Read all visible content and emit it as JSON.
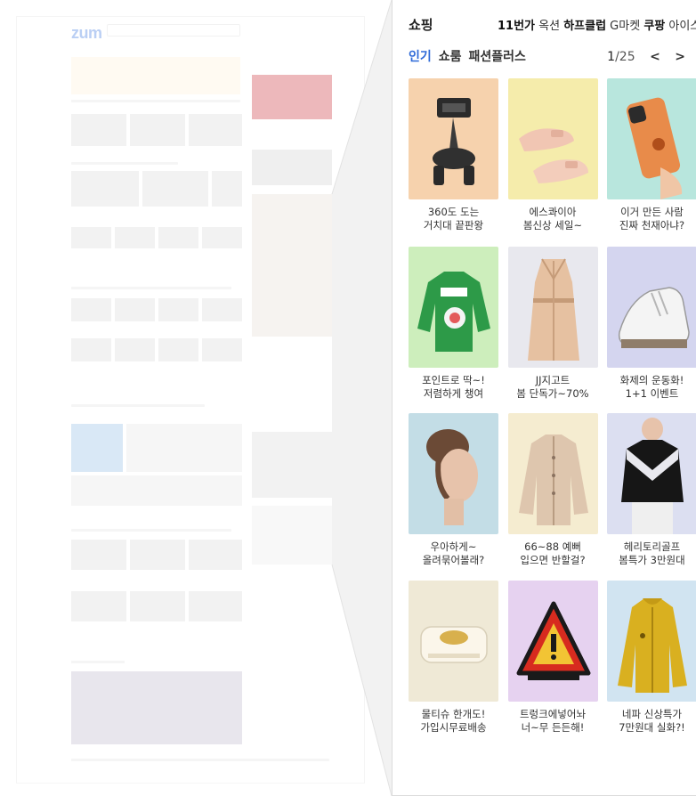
{
  "panel": {
    "title": "쇼핑",
    "malls": [
      {
        "text": "11번가",
        "bold": true
      },
      {
        "text": " 옥션 ",
        "bold": false
      },
      {
        "text": "하프클럽",
        "bold": true
      },
      {
        "text": " G마켓 ",
        "bold": false
      },
      {
        "text": "쿠팡",
        "bold": true
      },
      {
        "text": " 아이스탁몰",
        "bold": false
      }
    ],
    "tabs": [
      {
        "label": "인기",
        "active": true
      },
      {
        "label": "쇼룸",
        "active": false
      },
      {
        "label": "패션플러스",
        "active": false
      }
    ],
    "pager": {
      "current": "1",
      "total": "/25",
      "prev": "<",
      "next": ">"
    }
  },
  "products": [
    {
      "line1": "360도 도는",
      "line2": "거치대 끝판왕",
      "bg": "#f6d2ad",
      "icon": "phone-mount-icon"
    },
    {
      "line1": "에스콰이아",
      "line2": "봄신상 세일~",
      "bg": "#f5ecab",
      "icon": "shoes-icon"
    },
    {
      "line1": "이거 만든 사람",
      "line2": "진짜 천재아냐?",
      "bg": "#b8e6dd",
      "icon": "phone-case-icon"
    },
    {
      "line1": "포인트로 딱~!",
      "line2": "저렴하게 챙여",
      "bg": "#cdeebc",
      "icon": "sweater-icon"
    },
    {
      "line1": "JJ지고트",
      "line2": "봄 단독가~70%",
      "bg": "#e8e8ee",
      "icon": "trench-coat-icon"
    },
    {
      "line1": "화제의 운동화!",
      "line2": "1+1 이벤트",
      "bg": "#d4d5ef",
      "icon": "sneaker-icon"
    },
    {
      "line1": "우아하게~",
      "line2": "올려묶어볼래?",
      "bg": "#c3dde6",
      "icon": "hair-model-icon"
    },
    {
      "line1": "66~88 예뻐",
      "line2": "입으면 반할걸?",
      "bg": "#f5ecd0",
      "icon": "cardigan-icon"
    },
    {
      "line1": "헤리토리골프",
      "line2": "봄특가 3만원대",
      "bg": "#dcdff1",
      "icon": "golf-sweater-icon"
    },
    {
      "line1": "물티슈 한개도!",
      "line2": "가입시무료배송",
      "bg": "#efe9d6",
      "icon": "wet-tissue-icon"
    },
    {
      "line1": "트렁크에넣어놔",
      "line2": "너~무 든든해!",
      "bg": "#e6d2f0",
      "icon": "warning-triangle-icon"
    },
    {
      "line1": "네파 신상특가",
      "line2": "7만원대 실화?!",
      "bg": "#d1e4f1",
      "icon": "fleece-jacket-icon"
    }
  ],
  "background_page": {
    "logo": "zum"
  }
}
